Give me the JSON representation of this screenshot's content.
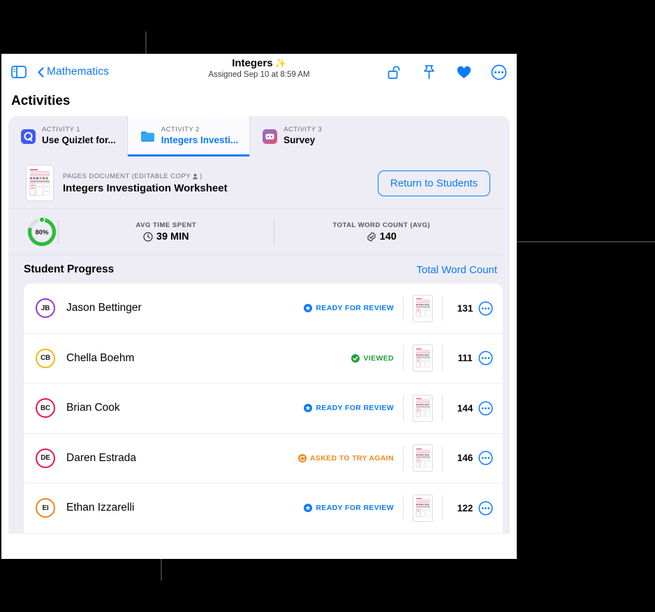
{
  "toolbar": {
    "sidebar_icon": "sidebar-toggle-icon",
    "back_chevron_icon": "chevron-left-icon",
    "back_label": "Mathematics",
    "title": "Integers",
    "title_sparkle": "✨",
    "subtitle": "Assigned Sep 10 at 8:59 AM",
    "actions": [
      {
        "name": "unlock-icon",
        "label": "Unlock"
      },
      {
        "name": "pin-icon",
        "label": "Pin"
      },
      {
        "name": "heart-icon",
        "label": "Favorite"
      },
      {
        "name": "more-options-icon",
        "label": "More"
      }
    ]
  },
  "page": {
    "title": "Activities"
  },
  "tabs": [
    {
      "kicker": "ACTIVITY 1",
      "name": "Use Quizlet for...",
      "icon": "quizlet-icon",
      "active": false
    },
    {
      "kicker": "ACTIVITY 2",
      "name": "Integers Investi...",
      "icon": "folder-icon",
      "active": true
    },
    {
      "kicker": "ACTIVITY 3",
      "name": "Survey",
      "icon": "survey-app-icon",
      "active": false
    }
  ],
  "document": {
    "kicker": "PAGES DOCUMENT (EDITABLE COPY ",
    "kicker_person_icon": "person-icon",
    "kicker_close": ")",
    "name": "Integers Investigation Worksheet",
    "thumbnail_icon": "worksheet-thumbnail",
    "return_button": "Return to Students"
  },
  "stats": {
    "ring_percent": 80,
    "ring_label": "80%",
    "ring_color": "#2bbd3e",
    "items": [
      {
        "label": "AVG TIME SPENT",
        "value": "39 MIN",
        "icon": "clock-icon"
      },
      {
        "label": "TOTAL WORD COUNT (AVG)",
        "value": "140",
        "icon": "badge-check-icon"
      }
    ]
  },
  "progress": {
    "title": "Student Progress",
    "total_link": "Total Word Count"
  },
  "students": [
    {
      "initials": "JB",
      "name": "Jason Bettinger",
      "ring": "#a033cc",
      "status": "READY FOR REVIEW",
      "status_kind": "blue",
      "status_icon": "burst-circle-icon",
      "word_count": "131",
      "thumb": "worksheet-thumbnail",
      "more": "more-options-icon"
    },
    {
      "initials": "CB",
      "name": "Chella Boehm",
      "ring": "#f2b718",
      "status": "VIEWED",
      "status_kind": "green",
      "status_icon": "check-circle-icon",
      "word_count": "111",
      "thumb": "worksheet-thumbnail",
      "more": "more-options-icon"
    },
    {
      "initials": "BC",
      "name": "Brian Cook",
      "ring": "#e8174b",
      "status": "READY FOR REVIEW",
      "status_kind": "blue",
      "status_icon": "burst-circle-icon",
      "word_count": "144",
      "thumb": "worksheet-thumbnail",
      "more": "more-options-icon"
    },
    {
      "initials": "DE",
      "name": "Daren Estrada",
      "ring": "#e8174b",
      "status": "ASKED TO TRY AGAIN",
      "status_kind": "orange",
      "status_icon": "retry-circle-icon",
      "word_count": "146",
      "thumb": "worksheet-thumbnail",
      "more": "more-options-icon"
    },
    {
      "initials": "EI",
      "name": "Ethan Izzarelli",
      "ring": "#f58420",
      "status": "READY FOR REVIEW",
      "status_kind": "blue",
      "status_icon": "burst-circle-icon",
      "word_count": "122",
      "thumb": "worksheet-thumbnail",
      "more": "more-options-icon"
    }
  ],
  "colors": {
    "accent": "#0a7aff",
    "card_bg": "#eeedf5",
    "green": "#21a038",
    "orange": "#f5881f"
  }
}
